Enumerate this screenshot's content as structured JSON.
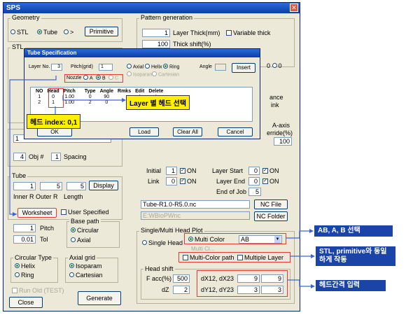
{
  "window": {
    "title": "SPS"
  },
  "geometry": {
    "label": "Geometry",
    "options": [
      "STL",
      "Tube",
      "> "
    ],
    "primitive_button": "Primitive"
  },
  "stl_group": {
    "label": "STL"
  },
  "pattern": {
    "label": "Pattern generation",
    "layer_thick_value": "1",
    "layer_thick_label": "Layer Thick(mm)",
    "variable_thick_label": "Variable thick",
    "thick_shift_value": "100",
    "thick_shift_label": "Thick shift(%)"
  },
  "partials": {
    "zero_c": "0",
    "zero_d": "0",
    "ance": "ance",
    "ink": "ink",
    "a_axis": "A-axis",
    "erride": "erride(%)",
    "erride_value": "100"
  },
  "obj": {
    "value": "4",
    "obj_label": "Obj #",
    "spacing_value": "1",
    "spacing_label": "Spacing",
    "top_value": "1"
  },
  "status": {
    "initial_label": "Initial",
    "initial_value": "1",
    "initial_on": "ON",
    "link_label": "Link",
    "link_value": "0",
    "link_on": "ON",
    "layer_start_label": "Layer Start",
    "layer_start_value": "0",
    "layer_start_on": "ON",
    "layer_end_label": "Layer End",
    "layer_end_value": "0",
    "layer_end_on": "ON",
    "end_of_job_label": "End of Job",
    "end_of_job_value": "5"
  },
  "tube": {
    "label": "Tube",
    "inner_value": "1",
    "outer_value": "5",
    "length_value": "5",
    "inner_label": "Inner R",
    "outer_label": "Outer R",
    "length_label": "Length",
    "display_button": "Display",
    "worksheet_button": "Worksheet",
    "user_specified_label": "User Specified"
  },
  "base_path": {
    "label": "Base path",
    "pitch_value": "1",
    "pitch_label": "Pitch",
    "tol_value": "0.01",
    "tol_label": "Tol",
    "options": [
      "Circular",
      "Axial"
    ]
  },
  "circular_type": {
    "label": "Circular Type",
    "options": [
      "Helix",
      "Ring"
    ]
  },
  "axial_grid": {
    "label": "Axial grid",
    "options": [
      "Isoparam",
      "Cartesian"
    ]
  },
  "footer": {
    "run_old_label": "Run Old (TEST)",
    "close_button": "Close",
    "generate_button": "Generate"
  },
  "nc": {
    "file_path": "Tube-R1.0-R5.0.nc",
    "folder_path": "E:WBioPWnc",
    "nc_file_button": "NC File",
    "nc_folder_button": "NC Folder"
  },
  "head_plot": {
    "label": "Single/Multi Head Plot",
    "single_head_label": "Single Head",
    "multi_color_label": "Multi Color",
    "multi_color_select": "AB",
    "sub_gray": "Multi Cl...",
    "multi_color_path_label": "Multi-Color path",
    "multiple_layer_label": "Multiple Layer",
    "head_shift_label": "Head shift",
    "facc_label": "F acc(%)",
    "facc_value": "500",
    "dz_label": "dZ",
    "dz_value": "2",
    "dx_label": "dX12, dX23",
    "dx1": "9",
    "dx2": "9",
    "dy_label": "dY12, dY23",
    "dy1": "3",
    "dy2": "3"
  },
  "dialog": {
    "title": "Tube Specification",
    "layer_no_label": "Layer No.",
    "layer_no_value": "3",
    "pitch_grid_label": "Pitch(grid)",
    "pitch_grid_value": "1",
    "path_options": [
      "Axial",
      "Helix",
      "Ring"
    ],
    "grid_options": [
      "Isoparam",
      "Cartesian"
    ],
    "angle_label": "Angle",
    "insert_button": "Insert",
    "nozzle_label": "Nozzle",
    "nozzle_options": [
      "A",
      "B",
      "C"
    ],
    "columns": [
      "NO",
      "Head",
      "Pitch",
      "Type",
      "Angle",
      "Rmks",
      "Edit",
      "Delete"
    ],
    "rows": [
      [
        "1",
        "0",
        "1.00",
        "0",
        "90",
        "",
        "*",
        "*"
      ],
      [
        "2",
        "1",
        "1.00",
        "2",
        "0",
        "",
        "*",
        "*"
      ]
    ],
    "ok_button": "OK",
    "load_button": "Load",
    "clear_all_button": "Clear All",
    "cancel_button": "Cancel"
  },
  "annotations": {
    "layer_head_select": "Layer 별 헤드 선택",
    "head_index": "헤드 index: 0,1",
    "ab_select": "AB, A, B 선택",
    "stl_primitive": "STL, primitive와 동일하게 작동",
    "head_gap_input": "헤드간격 입력"
  }
}
